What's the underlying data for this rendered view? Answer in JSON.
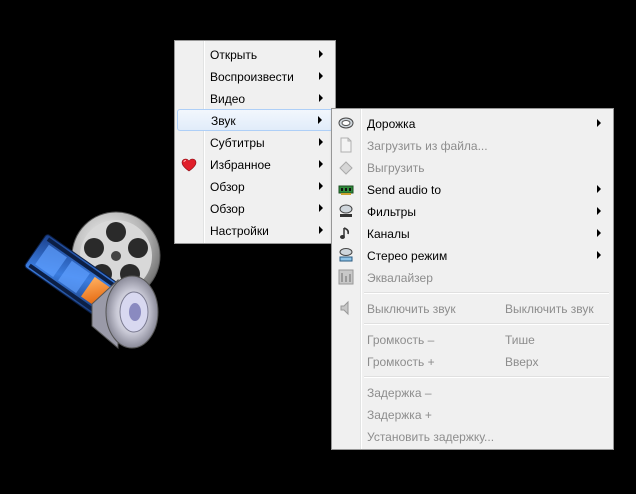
{
  "main_menu": {
    "items": [
      {
        "label": "Открыть"
      },
      {
        "label": "Воспроизвести"
      },
      {
        "label": "Видео"
      },
      {
        "label": "Звук"
      },
      {
        "label": "Субтитры"
      },
      {
        "label": "Избранное"
      },
      {
        "label": "Обзор"
      },
      {
        "label": "Обзор"
      },
      {
        "label": "Настройки"
      }
    ]
  },
  "sound_menu": {
    "items": [
      {
        "label": "Дорожка",
        "enabled": true,
        "submenu": true
      },
      {
        "label": "Загрузить из файла...",
        "enabled": false
      },
      {
        "label": "Выгрузить",
        "enabled": false
      },
      {
        "label": "Send audio to",
        "enabled": true,
        "submenu": true
      },
      {
        "label": "Фильтры",
        "enabled": true,
        "submenu": true
      },
      {
        "label": "Каналы",
        "enabled": true,
        "submenu": true
      },
      {
        "label": "Стерео режим",
        "enabled": true,
        "submenu": true
      },
      {
        "label": "Эквалайзер",
        "enabled": false
      },
      {
        "label": "Выключить звук",
        "shortcut": "Выключить звук",
        "enabled": false
      },
      {
        "label": "Громкость –",
        "shortcut": "Тише",
        "enabled": false
      },
      {
        "label": "Громкость +",
        "shortcut": "Вверх",
        "enabled": false
      },
      {
        "label": "Задержка –",
        "enabled": false
      },
      {
        "label": "Задержка +",
        "enabled": false
      },
      {
        "label": "Установить задержку...",
        "enabled": false
      }
    ]
  },
  "colors": {
    "background": "#000000",
    "menu_bg": "#f0f0f0",
    "highlight_border": "#aecff7",
    "disabled_text": "#8d8d8d"
  }
}
